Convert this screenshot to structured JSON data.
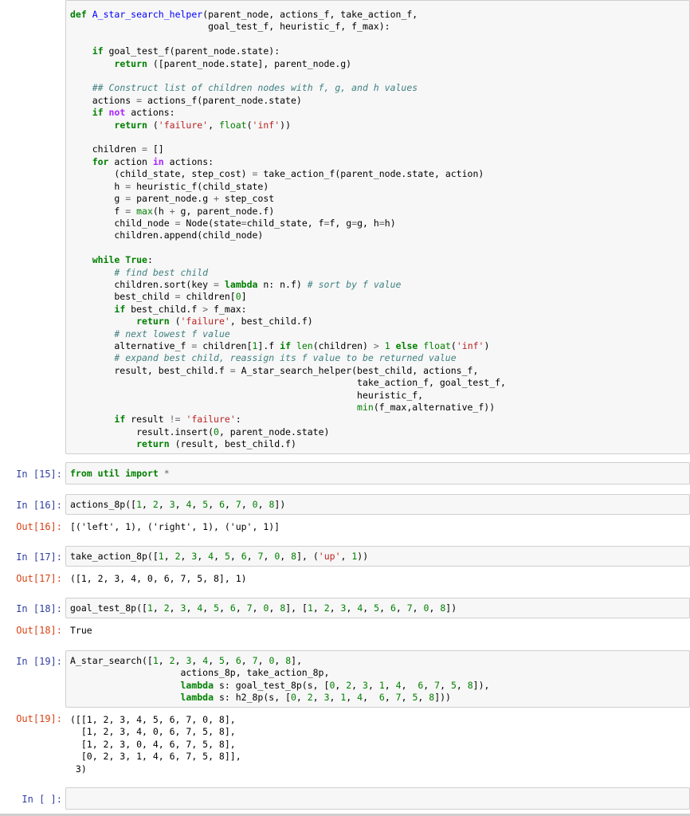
{
  "cells": [
    {
      "id": "cell-14",
      "prompt": ""
    },
    {
      "id": "cell-15",
      "prompt": "In [15]:",
      "code": "from util import *"
    },
    {
      "id": "cell-16",
      "prompt": "In [16]:",
      "code": "actions_8p([1, 2, 3, 4, 5, 6, 7, 0, 8])",
      "out_prompt": "Out[16]:",
      "output": "[('left', 1), ('right', 1), ('up', 1)]"
    },
    {
      "id": "cell-17",
      "prompt": "In [17]:",
      "code": "take_action_8p([1, 2, 3, 4, 5, 6, 7, 0, 8], ('up', 1))",
      "out_prompt": "Out[17]:",
      "output": "([1, 2, 3, 4, 0, 6, 7, 5, 8], 1)"
    },
    {
      "id": "cell-18",
      "prompt": "In [18]:",
      "code": "goal_test_8p([1, 2, 3, 4, 5, 6, 7, 0, 8], [1, 2, 3, 4, 5, 6, 7, 0, 8])",
      "out_prompt": "Out[18]:",
      "output": "True"
    },
    {
      "id": "cell-19",
      "prompt": "In [19]:",
      "code": "A_star_search([1, 2, 3, 4, 5, 6, 7, 0, 8],\n                    actions_8p, take_action_8p,\n                    lambda s: goal_test_8p(s, [0, 2, 3, 1, 4,  6, 7, 5, 8]),\n                    lambda s: h2_8p(s, [0, 2, 3, 1, 4,  6, 7, 5, 8]))",
      "out_prompt": "Out[19]:",
      "output": "([[1, 2, 3, 4, 5, 6, 7, 0, 8],\n  [1, 2, 3, 4, 0, 6, 7, 5, 8],\n  [1, 2, 3, 0, 4, 6, 7, 5, 8],\n  [0, 2, 3, 1, 4, 6, 7, 5, 8]],\n 3)"
    },
    {
      "id": "cell-empty",
      "prompt": "In [ ]:",
      "code": ""
    }
  ],
  "colors": {
    "prompt_in": "#303f9f",
    "prompt_out": "#d84315",
    "cell_bg": "#f7f7f7",
    "cell_border": "#cfcfcf",
    "keyword": "#008000",
    "string": "#ba2121",
    "comment": "#408080",
    "function_name": "#0000ff"
  }
}
